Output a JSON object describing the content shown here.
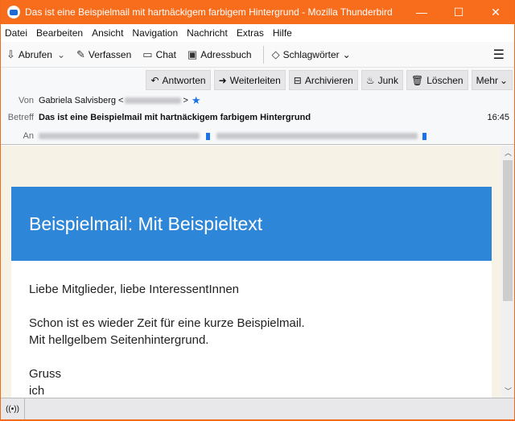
{
  "window": {
    "title": "Das ist eine Beispielmail mit hartnäckigem farbigem Hintergrund - Mozilla Thunderbird"
  },
  "menu": [
    "Datei",
    "Bearbeiten",
    "Ansicht",
    "Navigation",
    "Nachricht",
    "Extras",
    "Hilfe"
  ],
  "toolbar": {
    "get": "Abrufen",
    "write": "Verfassen",
    "chat": "Chat",
    "addressbook": "Adressbuch",
    "tags": "Schlagwörter"
  },
  "actions": {
    "reply": "Antworten",
    "forward": "Weiterleiten",
    "archive": "Archivieren",
    "junk": "Junk",
    "delete": "Löschen",
    "more": "Mehr"
  },
  "header": {
    "from_label": "Von",
    "from_name": "Gabriela Salvisberg <",
    "from_end": ">",
    "subject_label": "Betreff",
    "subject": "Das ist eine Beispielmail mit hartnäckigem farbigem Hintergrund",
    "time": "16:45",
    "to_label": "An"
  },
  "message": {
    "banner": "Beispielmail: Mit Beispieltext",
    "greeting": "Liebe Mitglieder, liebe InteressentInnen",
    "line1": "Schon ist es wieder Zeit für eine kurze Beispielmail.",
    "line2": "Mit hellgelbem Seitenhintergrund.",
    "closing1": "Gruss",
    "closing2": "ich"
  }
}
